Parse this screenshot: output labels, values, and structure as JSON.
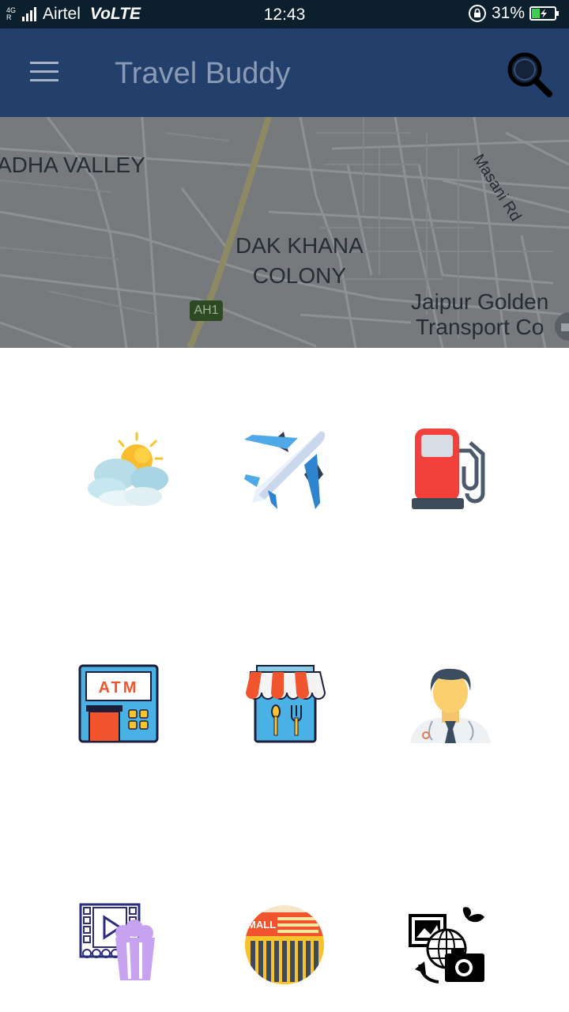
{
  "status_bar": {
    "network_type": "4G",
    "roaming": "R",
    "carrier": "Airtel",
    "volte": "VoLTE",
    "time": "12:43",
    "battery": "31%"
  },
  "app_bar": {
    "title": "Travel Buddy",
    "menu_icon": "hamburger-icon",
    "search_icon": "search-icon"
  },
  "map": {
    "labels": {
      "radha_valley": "ADHA VALLEY",
      "dak_khana": "DAK KHANA\nCOLONY",
      "masani_rd": "Masani Rd",
      "jaipur_golden": "Jaipur Golden\nTransport Co",
      "road_badge": "AH1"
    }
  },
  "categories": [
    {
      "icon": "weather-icon"
    },
    {
      "icon": "airplane-icon"
    },
    {
      "icon": "fuel-pump-icon"
    },
    {
      "icon": "atm-icon",
      "label": "ATM"
    },
    {
      "icon": "restaurant-icon"
    },
    {
      "icon": "doctor-icon"
    },
    {
      "icon": "cinema-icon"
    },
    {
      "icon": "mall-icon",
      "label": "MALL"
    },
    {
      "icon": "tourism-icon"
    }
  ],
  "colors": {
    "status_bar": "#0b1f2d",
    "app_bar": "#233f6b",
    "app_title": "#8b9bb5",
    "map_bg": "#767a7d"
  }
}
